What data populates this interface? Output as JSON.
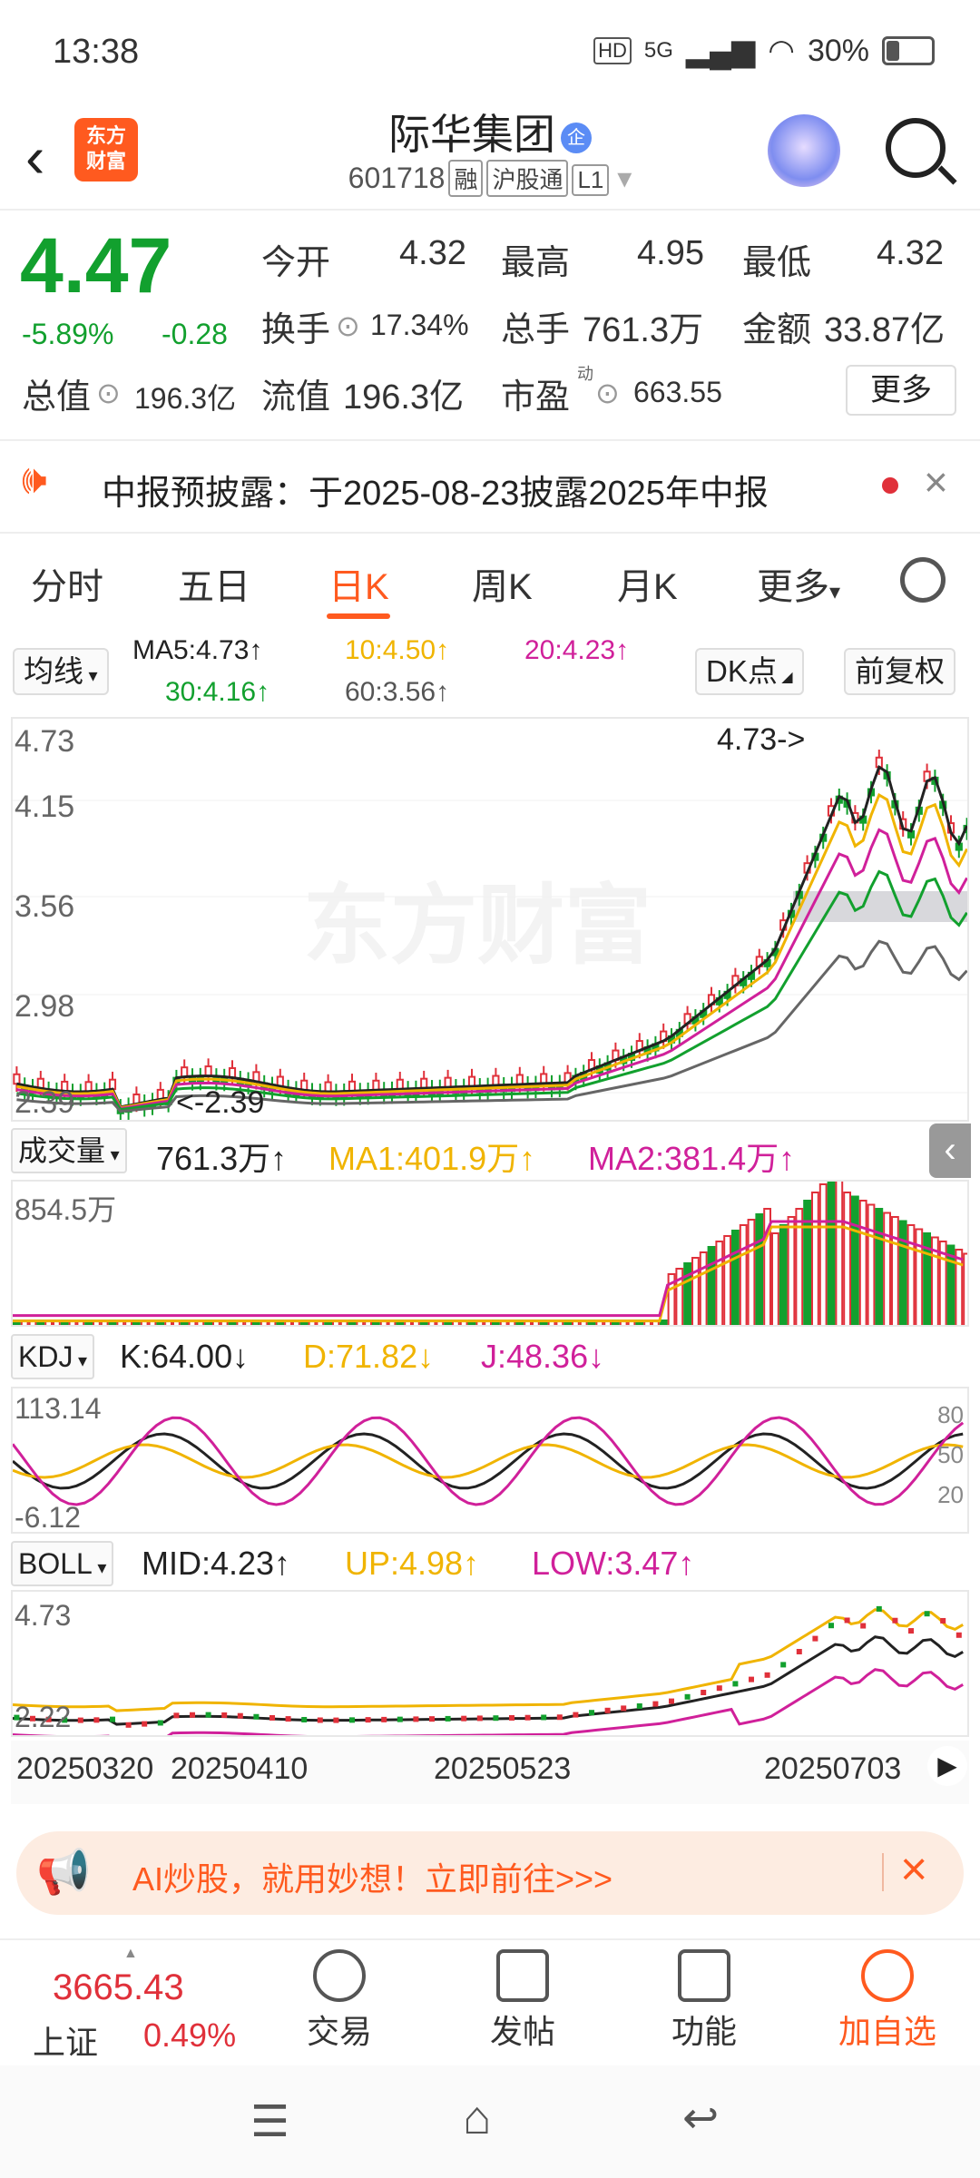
{
  "status": {
    "time": "13:38",
    "network": "5G",
    "battery": "30%"
  },
  "header": {
    "title": "际华集团",
    "code": "601718",
    "tags": [
      "融",
      "沪股通",
      "L1"
    ],
    "logo_line1": "东方",
    "logo_line2": "财富"
  },
  "quote": {
    "price": "4.47",
    "change_pct": "-5.89%",
    "change": "-0.28",
    "open_label": "今开",
    "open": "4.32",
    "high_label": "最高",
    "high": "4.95",
    "low_label": "最低",
    "low": "4.32",
    "turnover_label": "换手",
    "turnover": "17.34%",
    "volume_label": "总手",
    "volume": "761.3万",
    "amount_label": "金额",
    "amount": "33.87亿",
    "mktcap_label": "总值",
    "mktcap": "196.3亿",
    "float_label": "流值",
    "float_cap": "196.3亿",
    "pe_label": "市盈",
    "pe_sup": "动",
    "pe": "663.55",
    "more_btn": "更多"
  },
  "notice": {
    "text": "中报预披露：于2025-08-23披露2025年中报"
  },
  "tabs": [
    "分时",
    "五日",
    "日K",
    "周K",
    "月K",
    "更多"
  ],
  "ma_legend": {
    "selector": "均线",
    "ma5": "MA5:4.73↑",
    "ma10": "10:4.50↑",
    "ma20": "20:4.23↑",
    "ma30": "30:4.16↑",
    "ma60": "60:3.56↑",
    "dk": "DK点",
    "adj": "前复权"
  },
  "kline": {
    "y_labels": [
      "4.73",
      "4.15",
      "3.56",
      "2.98",
      "2.39"
    ],
    "high_marker": "4.73->",
    "low_marker": "<-2.39",
    "watermark": "东方财富"
  },
  "volume": {
    "selector": "成交量",
    "value": "761.3万↑",
    "ma1": "MA1:401.9万↑",
    "ma2": "MA2:381.4万↑",
    "y_label": "854.5万"
  },
  "kdj": {
    "selector": "KDJ",
    "k": "K:64.00↓",
    "d": "D:71.82↓",
    "j": "J:48.36↓",
    "y_top": "113.14",
    "y_bot": "-6.12",
    "lvl80": "80",
    "lvl50": "50",
    "lvl20": "20"
  },
  "boll": {
    "selector": "BOLL",
    "mid": "MID:4.23↑",
    "up": "UP:4.98↑",
    "low": "LOW:3.47↑",
    "y_top": "4.73",
    "y_bot": "2.22"
  },
  "dates": [
    "20250320",
    "20250410",
    "20250523",
    "20250703"
  ],
  "ad": {
    "text": "AI炒股，就用妙想！立即前往>>>"
  },
  "bottom": {
    "index_value": "3665.43",
    "index_name": "上证",
    "index_chg": "0.49%",
    "trade": "交易",
    "post": "发帖",
    "func": "功能",
    "add": "加自选"
  },
  "colors": {
    "up": "#e0303a",
    "down": "#12a02e",
    "accent": "#ff5a1f",
    "ma10": "#f0b400",
    "ma20": "#d0209a"
  }
}
